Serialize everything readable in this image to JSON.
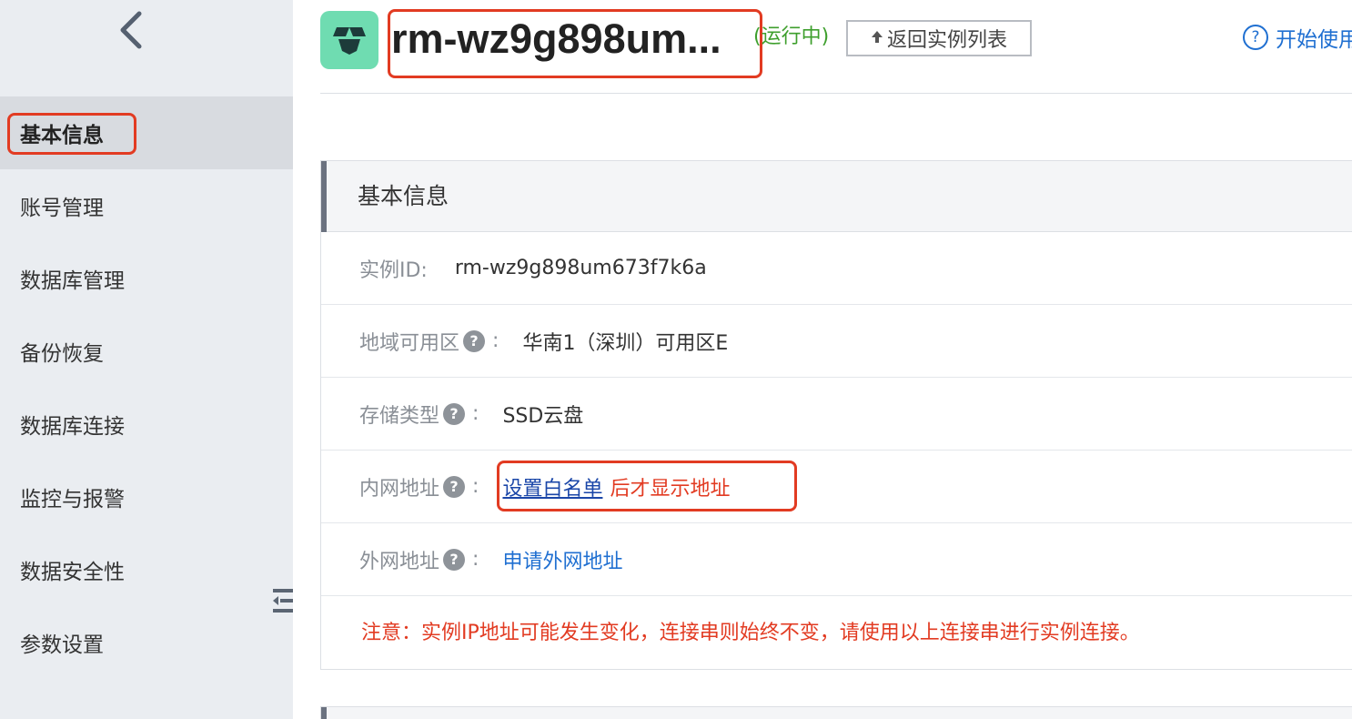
{
  "sidebar": {
    "back_icon": "chevron-left-icon",
    "items": [
      {
        "label": "基本信息",
        "active": true
      },
      {
        "label": "账号管理"
      },
      {
        "label": "数据库管理"
      },
      {
        "label": "备份恢复"
      },
      {
        "label": "数据库连接"
      },
      {
        "label": "监控与报警"
      },
      {
        "label": "数据安全性"
      },
      {
        "label": "参数设置"
      }
    ],
    "collapse_icon": "collapse-sidebar-icon"
  },
  "header": {
    "instance_title": "rm-wz9g898um...",
    "status": "(运行中)",
    "back_to_list": "返回实例列表",
    "help_label": "开始使用"
  },
  "panel": {
    "title": "基本信息",
    "rows": {
      "instance_id": {
        "label": "实例ID:",
        "value": "rm-wz9g898um673f7k6a"
      },
      "zone": {
        "label": "地域可用区",
        "value": "华南1（深圳）可用区E"
      },
      "storage": {
        "label": "存储类型",
        "value": "SSD云盘"
      },
      "intranet": {
        "label": "内网地址",
        "link": "设置白名单",
        "suffix": "后才显示地址"
      },
      "internet": {
        "label": "外网地址",
        "link": "申请外网地址"
      }
    },
    "note": "注意：实例IP地址可能发生变化，连接串则始终不变，请使用以上连接串进行实例连接。"
  },
  "colors": {
    "accent_red": "#e23b22",
    "link_blue": "#1f6fd1",
    "status_green": "#3e9f2d",
    "logo_green": "#6fdcb1"
  }
}
